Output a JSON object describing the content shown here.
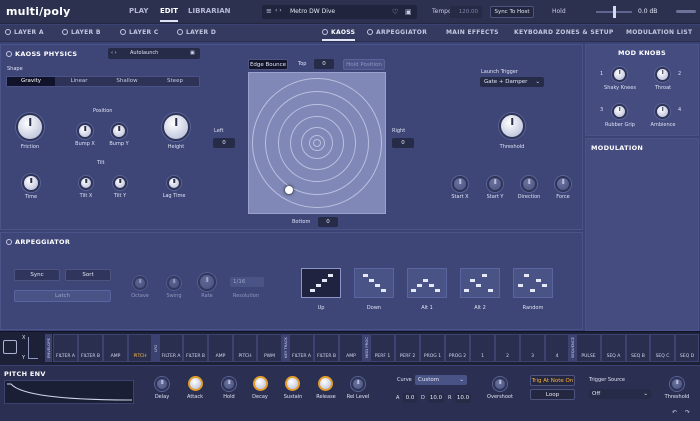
{
  "app": {
    "logo": "multi/poly"
  },
  "topnav": [
    "PLAY",
    "EDIT",
    "LIBRARIAN"
  ],
  "preset": {
    "name": "Metro DW Dive"
  },
  "header": {
    "tempo_label": "Tempo",
    "tempo_value": "120.00",
    "sync_button": "Sync To Host",
    "hold_label": "Hold",
    "db_value": "0.0 dB"
  },
  "layers": [
    "LAYER A",
    "LAYER B",
    "LAYER C",
    "LAYER D"
  ],
  "tabs": [
    "KAOSS",
    "ARPEGGIATOR",
    "MAIN EFFECTS",
    "KEYBOARD ZONES & SETUP",
    "MODULATION LIST"
  ],
  "kaoss": {
    "title": "KAOSS PHYSICS",
    "preset": "Autolaunch",
    "shape_label": "Shape",
    "shapes": [
      "Gravity",
      "Linear",
      "Shallow",
      "Steep"
    ],
    "position_label": "Position",
    "tilt_label": "Tilt",
    "knobs": {
      "friction": "Friction",
      "bump_x": "Bump X",
      "bump_y": "Bump Y",
      "height": "Height",
      "time": "Time",
      "tilt_x": "Tilt X",
      "tilt_y": "Tilt Y",
      "lag_time": "Lag Time"
    },
    "edge_bounce": "Edge Bounce",
    "top_label": "Top",
    "top_value": "0",
    "hold_position": "Hold Position",
    "left_label": "Left",
    "left_value": "0",
    "right_label": "Right",
    "right_value": "0",
    "bottom_label": "Bottom",
    "bottom_value": "0",
    "launch_trigger_label": "Launch Trigger",
    "launch_trigger_value": "Gate + Damper",
    "threshold": "Threshold",
    "start_knobs": [
      "Start X",
      "Start Y",
      "Direction",
      "Force"
    ]
  },
  "mod_knobs": {
    "title": "MOD KNOBS",
    "items": [
      {
        "n": "1",
        "label": "Shaky Knees"
      },
      {
        "n": "2",
        "label": "Throat"
      },
      {
        "n": "3",
        "label": "Rubber Grip"
      },
      {
        "n": "4",
        "label": "Ambience"
      }
    ]
  },
  "modulation": {
    "title": "MODULATION"
  },
  "arp": {
    "title": "ARPEGGIATOR",
    "sync": "Sync",
    "sort": "Sort",
    "latch": "Latch",
    "knobs": [
      "Octave",
      "Swing",
      "Rate"
    ],
    "resolution_value": "1/16",
    "resolution_label": "Resolution",
    "patterns": [
      "Up",
      "Down",
      "Alt 1",
      "Alt 2",
      "Random"
    ]
  },
  "mod_matrix": {
    "tags": [
      "ENVELOPE",
      "LFO",
      "KEY TRACK",
      "MOD PROC",
      "SEQUENCE"
    ],
    "slots": [
      "FILTER A",
      "FILTER B",
      "AMP",
      "PITCH",
      "FILTER A",
      "FILTER B",
      "AMP",
      "PITCH",
      "PWM",
      "FILTER A",
      "FILTER B",
      "AMP",
      "PERF 1",
      "PERF 2",
      "PROG 1",
      "PROG 2",
      "1",
      "2",
      "3",
      "4",
      "PULSE",
      "SEQ A",
      "SEQ B",
      "SEQ C",
      "SEQ D"
    ],
    "axis": [
      "X",
      "Y"
    ]
  },
  "pitch_env": {
    "title": "PITCH ENV",
    "knobs": [
      "Delay",
      "Attack",
      "Hold",
      "Decay",
      "Sustain",
      "Release",
      "Rel Level"
    ],
    "curve_label": "Curve",
    "curve_value": "Custom",
    "adr": [
      {
        "k": "A",
        "v": "0.0"
      },
      {
        "k": "D",
        "v": "10.0"
      },
      {
        "k": "R",
        "v": "10.0"
      }
    ],
    "overshoot": "Overshoot",
    "trig": "Trig At Note On",
    "loop": "Loop",
    "trigger_source_label": "Trigger Source",
    "trigger_source_value": "Off",
    "threshold": "Threshold"
  }
}
